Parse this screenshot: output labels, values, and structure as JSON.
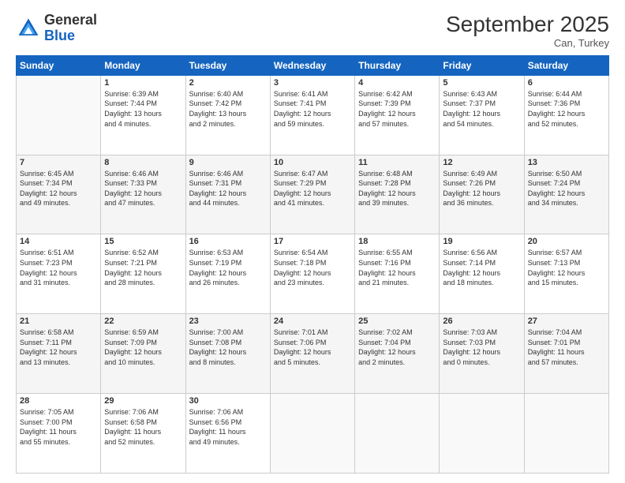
{
  "logo": {
    "general": "General",
    "blue": "Blue"
  },
  "header": {
    "month": "September 2025",
    "location": "Can, Turkey"
  },
  "days_of_week": [
    "Sunday",
    "Monday",
    "Tuesday",
    "Wednesday",
    "Thursday",
    "Friday",
    "Saturday"
  ],
  "weeks": [
    [
      {
        "day": "",
        "info": ""
      },
      {
        "day": "1",
        "info": "Sunrise: 6:39 AM\nSunset: 7:44 PM\nDaylight: 13 hours\nand 4 minutes."
      },
      {
        "day": "2",
        "info": "Sunrise: 6:40 AM\nSunset: 7:42 PM\nDaylight: 13 hours\nand 2 minutes."
      },
      {
        "day": "3",
        "info": "Sunrise: 6:41 AM\nSunset: 7:41 PM\nDaylight: 12 hours\nand 59 minutes."
      },
      {
        "day": "4",
        "info": "Sunrise: 6:42 AM\nSunset: 7:39 PM\nDaylight: 12 hours\nand 57 minutes."
      },
      {
        "day": "5",
        "info": "Sunrise: 6:43 AM\nSunset: 7:37 PM\nDaylight: 12 hours\nand 54 minutes."
      },
      {
        "day": "6",
        "info": "Sunrise: 6:44 AM\nSunset: 7:36 PM\nDaylight: 12 hours\nand 52 minutes."
      }
    ],
    [
      {
        "day": "7",
        "info": "Sunrise: 6:45 AM\nSunset: 7:34 PM\nDaylight: 12 hours\nand 49 minutes."
      },
      {
        "day": "8",
        "info": "Sunrise: 6:46 AM\nSunset: 7:33 PM\nDaylight: 12 hours\nand 47 minutes."
      },
      {
        "day": "9",
        "info": "Sunrise: 6:46 AM\nSunset: 7:31 PM\nDaylight: 12 hours\nand 44 minutes."
      },
      {
        "day": "10",
        "info": "Sunrise: 6:47 AM\nSunset: 7:29 PM\nDaylight: 12 hours\nand 41 minutes."
      },
      {
        "day": "11",
        "info": "Sunrise: 6:48 AM\nSunset: 7:28 PM\nDaylight: 12 hours\nand 39 minutes."
      },
      {
        "day": "12",
        "info": "Sunrise: 6:49 AM\nSunset: 7:26 PM\nDaylight: 12 hours\nand 36 minutes."
      },
      {
        "day": "13",
        "info": "Sunrise: 6:50 AM\nSunset: 7:24 PM\nDaylight: 12 hours\nand 34 minutes."
      }
    ],
    [
      {
        "day": "14",
        "info": "Sunrise: 6:51 AM\nSunset: 7:23 PM\nDaylight: 12 hours\nand 31 minutes."
      },
      {
        "day": "15",
        "info": "Sunrise: 6:52 AM\nSunset: 7:21 PM\nDaylight: 12 hours\nand 28 minutes."
      },
      {
        "day": "16",
        "info": "Sunrise: 6:53 AM\nSunset: 7:19 PM\nDaylight: 12 hours\nand 26 minutes."
      },
      {
        "day": "17",
        "info": "Sunrise: 6:54 AM\nSunset: 7:18 PM\nDaylight: 12 hours\nand 23 minutes."
      },
      {
        "day": "18",
        "info": "Sunrise: 6:55 AM\nSunset: 7:16 PM\nDaylight: 12 hours\nand 21 minutes."
      },
      {
        "day": "19",
        "info": "Sunrise: 6:56 AM\nSunset: 7:14 PM\nDaylight: 12 hours\nand 18 minutes."
      },
      {
        "day": "20",
        "info": "Sunrise: 6:57 AM\nSunset: 7:13 PM\nDaylight: 12 hours\nand 15 minutes."
      }
    ],
    [
      {
        "day": "21",
        "info": "Sunrise: 6:58 AM\nSunset: 7:11 PM\nDaylight: 12 hours\nand 13 minutes."
      },
      {
        "day": "22",
        "info": "Sunrise: 6:59 AM\nSunset: 7:09 PM\nDaylight: 12 hours\nand 10 minutes."
      },
      {
        "day": "23",
        "info": "Sunrise: 7:00 AM\nSunset: 7:08 PM\nDaylight: 12 hours\nand 8 minutes."
      },
      {
        "day": "24",
        "info": "Sunrise: 7:01 AM\nSunset: 7:06 PM\nDaylight: 12 hours\nand 5 minutes."
      },
      {
        "day": "25",
        "info": "Sunrise: 7:02 AM\nSunset: 7:04 PM\nDaylight: 12 hours\nand 2 minutes."
      },
      {
        "day": "26",
        "info": "Sunrise: 7:03 AM\nSunset: 7:03 PM\nDaylight: 12 hours\nand 0 minutes."
      },
      {
        "day": "27",
        "info": "Sunrise: 7:04 AM\nSunset: 7:01 PM\nDaylight: 11 hours\nand 57 minutes."
      }
    ],
    [
      {
        "day": "28",
        "info": "Sunrise: 7:05 AM\nSunset: 7:00 PM\nDaylight: 11 hours\nand 55 minutes."
      },
      {
        "day": "29",
        "info": "Sunrise: 7:06 AM\nSunset: 6:58 PM\nDaylight: 11 hours\nand 52 minutes."
      },
      {
        "day": "30",
        "info": "Sunrise: 7:06 AM\nSunset: 6:56 PM\nDaylight: 11 hours\nand 49 minutes."
      },
      {
        "day": "",
        "info": ""
      },
      {
        "day": "",
        "info": ""
      },
      {
        "day": "",
        "info": ""
      },
      {
        "day": "",
        "info": ""
      }
    ]
  ]
}
